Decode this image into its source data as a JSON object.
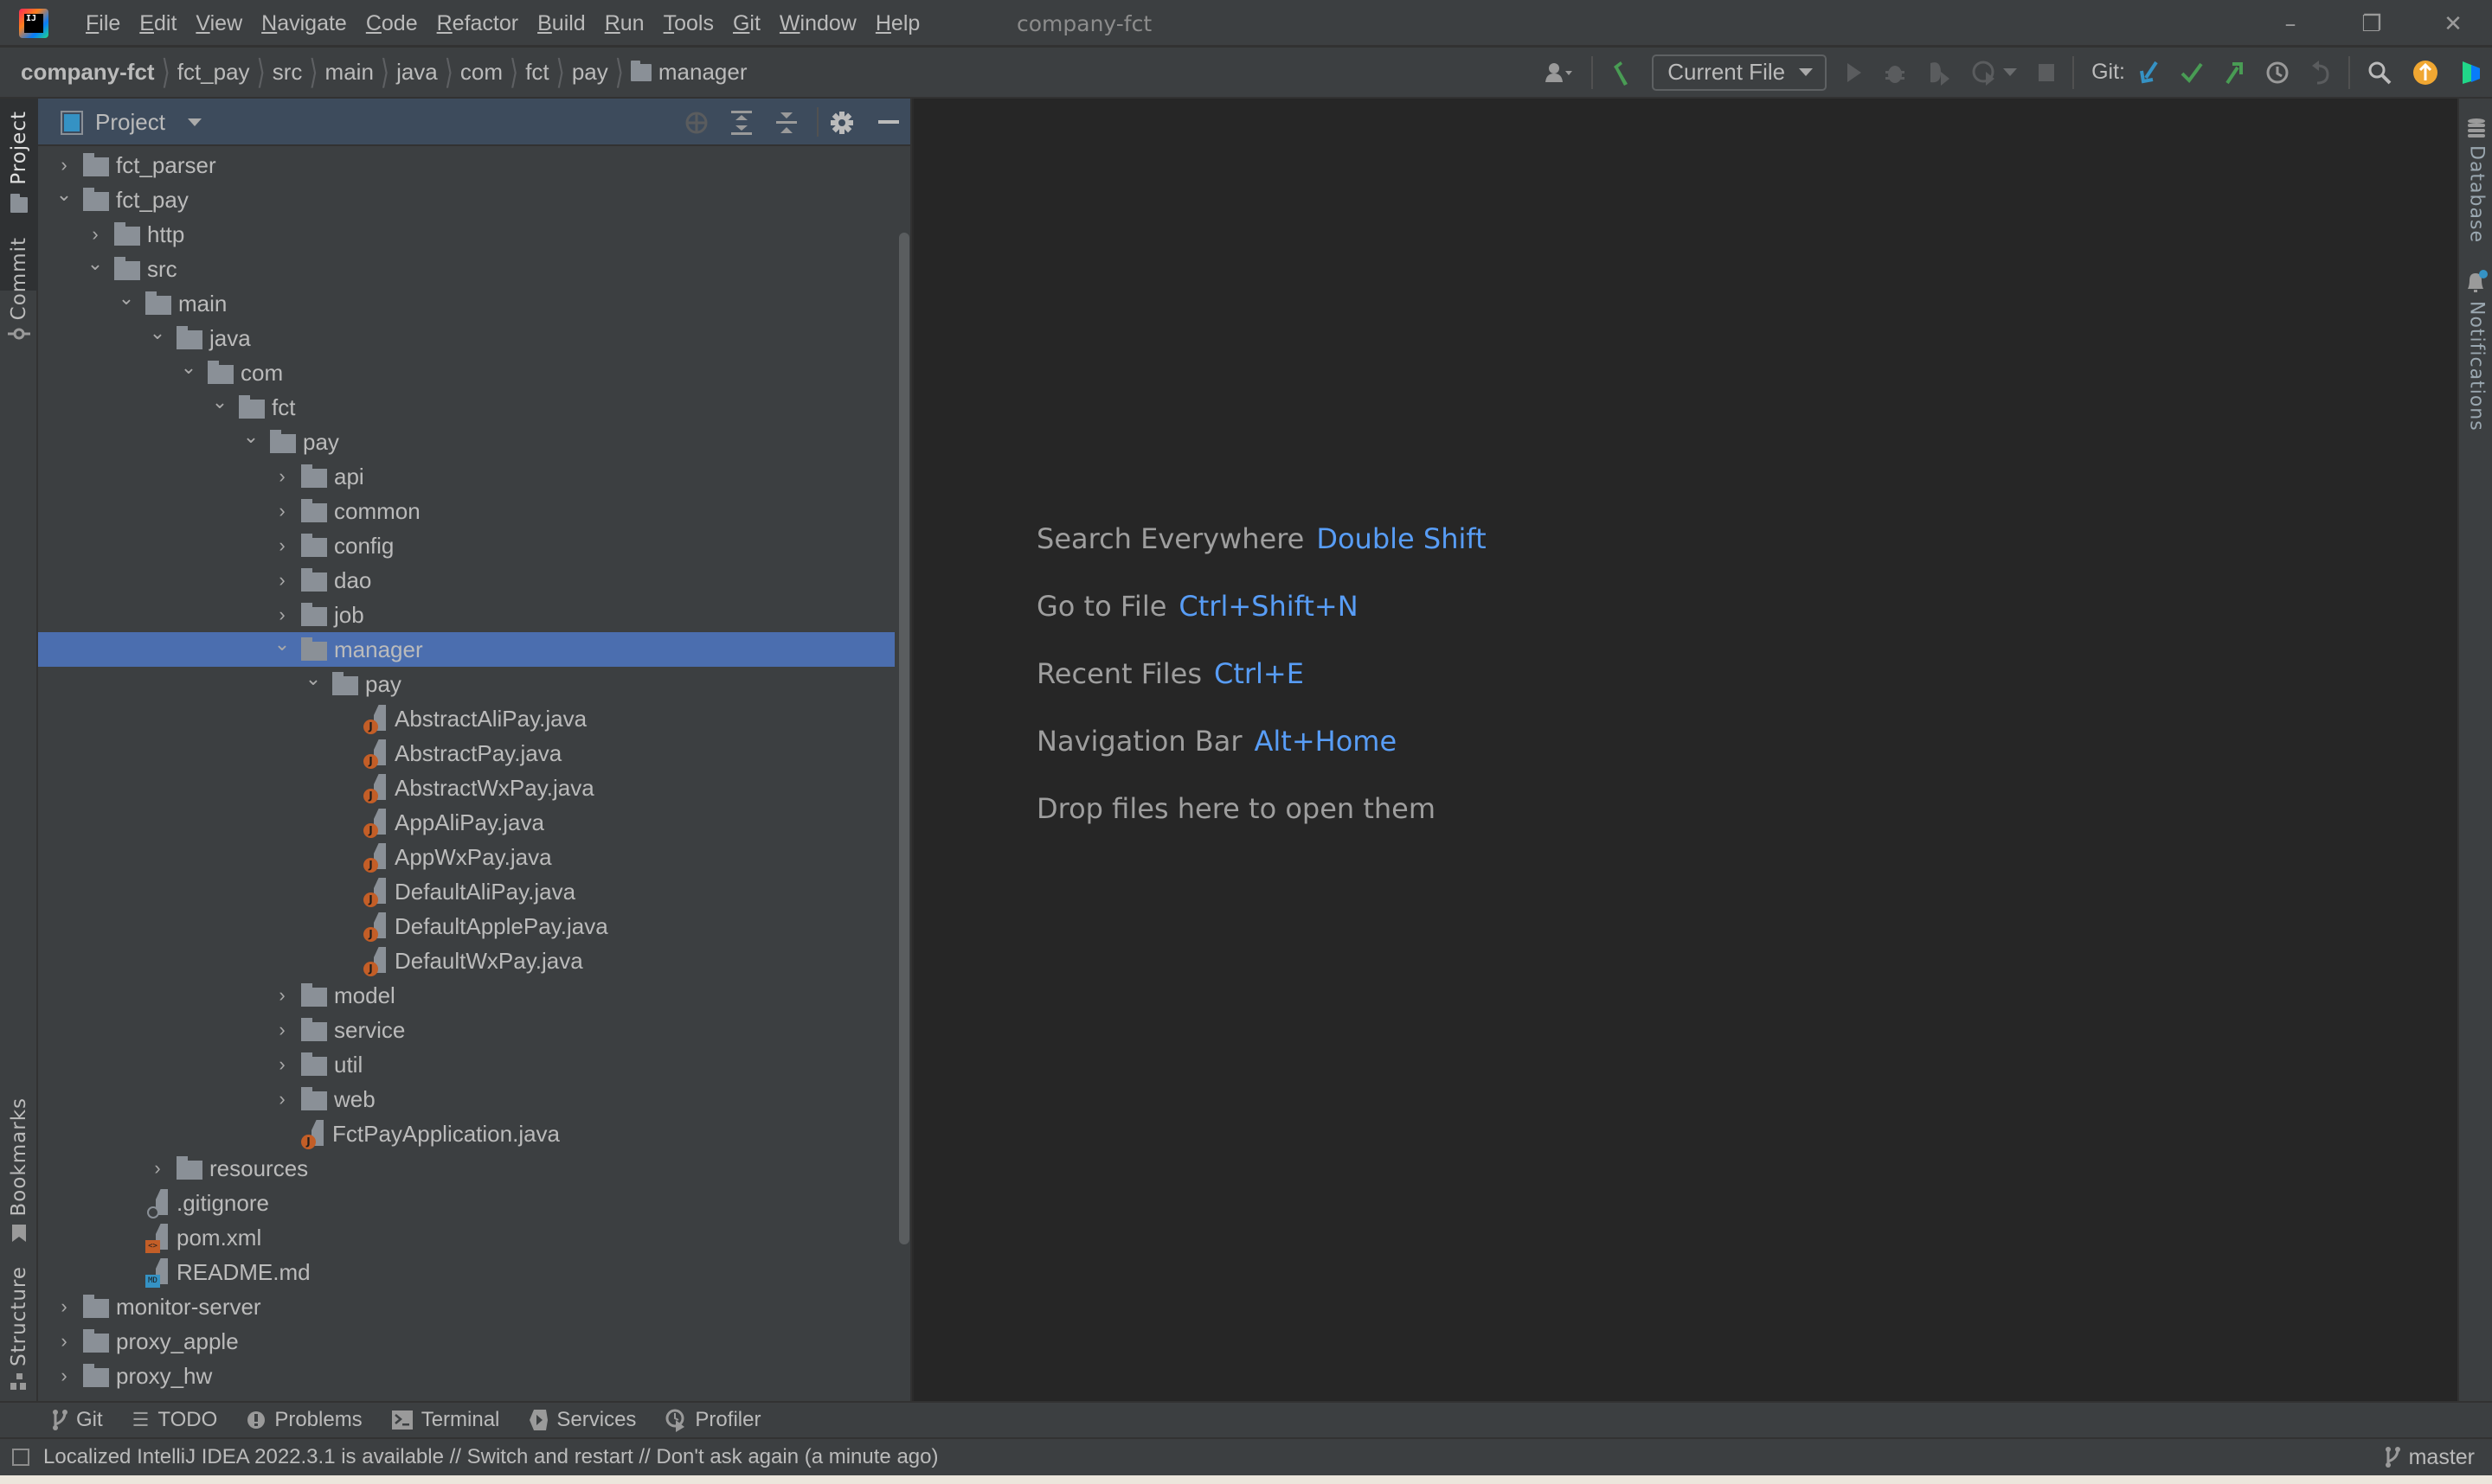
{
  "window": {
    "title": "company-fct",
    "menu": [
      "File",
      "Edit",
      "View",
      "Navigate",
      "Code",
      "Refactor",
      "Build",
      "Run",
      "Tools",
      "Git",
      "Window",
      "Help"
    ],
    "controls": {
      "minimize": "–",
      "restore": "❐",
      "close": "✕"
    }
  },
  "breadcrumb": [
    "company-fct",
    "fct_pay",
    "src",
    "main",
    "java",
    "com",
    "fct",
    "pay",
    "manager"
  ],
  "toolbar": {
    "run_config": "Current File",
    "git_label": "Git:",
    "icons": [
      "user-icon",
      "build-hammer-icon",
      "run-icon",
      "debug-icon",
      "coverage-icon",
      "profile-icon",
      "stop-icon",
      "git-update-icon",
      "git-commit-icon",
      "git-push-icon",
      "history-icon",
      "rollback-icon",
      "search-icon",
      "update-icon",
      "toolbox-icon"
    ]
  },
  "left_strip": {
    "tabs": [
      "Project",
      "Commit",
      "Bookmarks",
      "Structure"
    ]
  },
  "right_strip": {
    "tabs": [
      "Database",
      "Notifications"
    ]
  },
  "project_panel": {
    "title": "Project",
    "header_icons": [
      "locate-icon",
      "expand-all-icon",
      "collapse-all-icon",
      "gear-icon",
      "hide-icon"
    ],
    "tree": [
      {
        "label": "fct_parser",
        "depth": 0,
        "kind": "folder",
        "expanded": false
      },
      {
        "label": "fct_pay",
        "depth": 0,
        "kind": "folder",
        "expanded": true
      },
      {
        "label": "http",
        "depth": 1,
        "kind": "folder",
        "expanded": false
      },
      {
        "label": "src",
        "depth": 1,
        "kind": "folder",
        "expanded": true
      },
      {
        "label": "main",
        "depth": 2,
        "kind": "folder",
        "expanded": true
      },
      {
        "label": "java",
        "depth": 3,
        "kind": "folder",
        "expanded": true
      },
      {
        "label": "com",
        "depth": 4,
        "kind": "folder",
        "expanded": true
      },
      {
        "label": "fct",
        "depth": 5,
        "kind": "folder",
        "expanded": true
      },
      {
        "label": "pay",
        "depth": 6,
        "kind": "folder",
        "expanded": true
      },
      {
        "label": "api",
        "depth": 7,
        "kind": "folder",
        "expanded": false
      },
      {
        "label": "common",
        "depth": 7,
        "kind": "folder",
        "expanded": false
      },
      {
        "label": "config",
        "depth": 7,
        "kind": "folder",
        "expanded": false
      },
      {
        "label": "dao",
        "depth": 7,
        "kind": "folder",
        "expanded": false
      },
      {
        "label": "job",
        "depth": 7,
        "kind": "folder",
        "expanded": false
      },
      {
        "label": "manager",
        "depth": 7,
        "kind": "folder",
        "expanded": true,
        "selected": true
      },
      {
        "label": "pay",
        "depth": 8,
        "kind": "folder",
        "expanded": true
      },
      {
        "label": "AbstractAliPay.java",
        "depth": 9,
        "kind": "java"
      },
      {
        "label": "AbstractPay.java",
        "depth": 9,
        "kind": "java"
      },
      {
        "label": "AbstractWxPay.java",
        "depth": 9,
        "kind": "java"
      },
      {
        "label": "AppAliPay.java",
        "depth": 9,
        "kind": "java"
      },
      {
        "label": "AppWxPay.java",
        "depth": 9,
        "kind": "java"
      },
      {
        "label": "DefaultAliPay.java",
        "depth": 9,
        "kind": "java"
      },
      {
        "label": "DefaultApplePay.java",
        "depth": 9,
        "kind": "java"
      },
      {
        "label": "DefaultWxPay.java",
        "depth": 9,
        "kind": "java"
      },
      {
        "label": "model",
        "depth": 7,
        "kind": "folder",
        "expanded": false
      },
      {
        "label": "service",
        "depth": 7,
        "kind": "folder",
        "expanded": false
      },
      {
        "label": "util",
        "depth": 7,
        "kind": "folder",
        "expanded": false
      },
      {
        "label": "web",
        "depth": 7,
        "kind": "folder",
        "expanded": false
      },
      {
        "label": "FctPayApplication.java",
        "depth": 7,
        "kind": "java",
        "leaf_under_folder": true
      },
      {
        "label": "resources",
        "depth": 3,
        "kind": "folder",
        "expanded": false
      },
      {
        "label": ".gitignore",
        "depth": 2,
        "kind": "gitignore"
      },
      {
        "label": "pom.xml",
        "depth": 2,
        "kind": "xml"
      },
      {
        "label": "README.md",
        "depth": 2,
        "kind": "md"
      },
      {
        "label": "monitor-server",
        "depth": 0,
        "kind": "folder",
        "expanded": false
      },
      {
        "label": "proxy_apple",
        "depth": 0,
        "kind": "folder",
        "expanded": false
      },
      {
        "label": "proxy_hw",
        "depth": 0,
        "kind": "folder",
        "expanded": false
      }
    ]
  },
  "editor": {
    "hints": [
      {
        "action": "Search Everywhere",
        "shortcut": "Double Shift"
      },
      {
        "action": "Go to File",
        "shortcut": "Ctrl+Shift+N"
      },
      {
        "action": "Recent Files",
        "shortcut": "Ctrl+E"
      },
      {
        "action": "Navigation Bar",
        "shortcut": "Alt+Home"
      },
      {
        "action": "Drop files here to open them",
        "shortcut": ""
      }
    ]
  },
  "bottom_tabs": [
    {
      "label": "Git",
      "icon": "git-branch-icon"
    },
    {
      "label": "TODO",
      "icon": "list-icon"
    },
    {
      "label": "Problems",
      "icon": "warning-icon"
    },
    {
      "label": "Terminal",
      "icon": "terminal-icon"
    },
    {
      "label": "Services",
      "icon": "services-icon"
    },
    {
      "label": "Profiler",
      "icon": "profiler-icon"
    }
  ],
  "status": {
    "message": "Localized IntelliJ IDEA 2022.3.1 is available // Switch and restart // Don't ask again (a minute ago)",
    "branch": "master"
  },
  "colors": {
    "accent_link": "#589df6",
    "selection": "#4b6eaf",
    "java_badge": "#c35e27",
    "md_badge": "#3592c4"
  }
}
